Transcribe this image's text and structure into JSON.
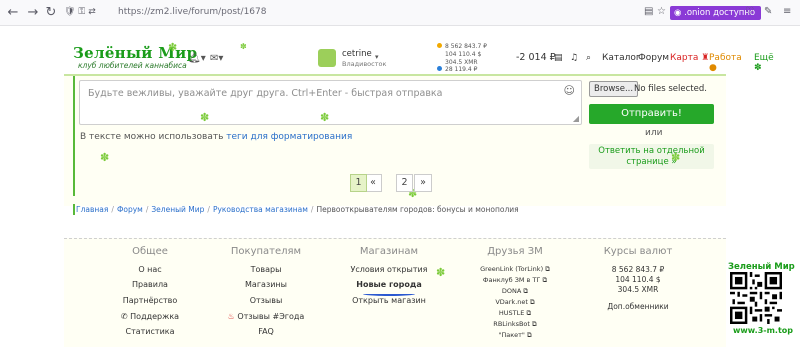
{
  "browser": {
    "url": "https://zm2.live/forum/post/1678",
    "onion_label": ".onion доступно"
  },
  "header": {
    "logo_title": "Зелёный Мир",
    "logo_subtitle": "клуб любителей каннабиса",
    "user_name": "cetrine",
    "user_city": "Владивосток",
    "balances": [
      "8 562 843.7 ₽",
      "104 110.4 $",
      "304.5 XMR",
      "28 119.4 ₽"
    ],
    "balance": "-2 014 ₽",
    "nav": {
      "catalog": "Каталог",
      "forum": "Форум",
      "map": "Карта",
      "work": "Работа",
      "more": "Ещё"
    }
  },
  "editor": {
    "placeholder": "Будьте вежливы, уважайте друг друга. Ctrl+Enter - быстрая отправка"
  },
  "upload": {
    "browse_label": "Browse...",
    "no_files": "No files selected."
  },
  "send_label": "Отправить!",
  "or_label": "или",
  "reply_link": "Ответить на отдельной странице »",
  "hint": {
    "prefix": "В тексте можно использовать ",
    "link": "теги для форматирования"
  },
  "pagination": {
    "prev": "«",
    "pages": [
      "1",
      "2"
    ],
    "next": "»",
    "current": "1"
  },
  "breadcrumb": [
    "Главная",
    "Форум",
    "Зеленый Мир",
    "Руководства магазинам",
    "Первооткрывателям городов: бонусы и монополия"
  ],
  "footer": {
    "general": {
      "title": "Общее",
      "items": [
        "О нас",
        "Правила",
        "Партнёрство",
        "Поддержка",
        "Статистика"
      ]
    },
    "buyers": {
      "title": "Покупателям",
      "items": [
        "Товары",
        "Магазины",
        "Отзывы",
        "Отзывы #Эгода",
        "FAQ"
      ]
    },
    "shops": {
      "title": "Магазинам",
      "items": [
        "Условия открытия",
        "Новые города",
        "Открыть магазин"
      ]
    },
    "friends": {
      "title": "Друзья ЗМ",
      "items": [
        "GreenLink (TorLink)",
        "Фанклуб ЗМ в ТГ",
        "DONA",
        "VDark.net",
        "HUSTLE",
        "RBLinksBot",
        "\"Пакет\""
      ]
    },
    "rates": {
      "title": "Курсы валют",
      "items": [
        "8 562 843.7 ₽",
        "104 110.4 $",
        "304.5 XMR",
        "Доп.обменники"
      ]
    },
    "qr_title": "Зеленый Мир",
    "qr_url": "www.3-m.top"
  }
}
